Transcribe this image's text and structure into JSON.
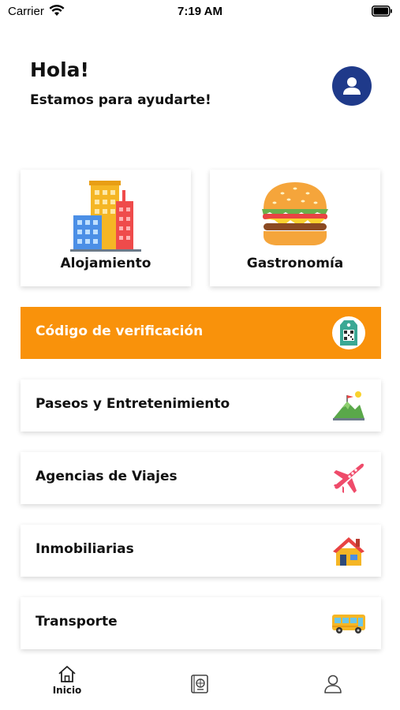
{
  "status_bar": {
    "carrier": "Carrier",
    "time": "7:19 AM"
  },
  "header": {
    "greeting": "Hola!",
    "subtitle": "Estamos para ayudarte!"
  },
  "categories": [
    {
      "label": "Alojamiento",
      "icon": "buildings-icon"
    },
    {
      "label": "Gastronomía",
      "icon": "burger-icon"
    }
  ],
  "menu": [
    {
      "label": "Código de verificación",
      "icon": "qr-tag-icon",
      "highlighted": true
    },
    {
      "label": "Paseos y Entretenimiento",
      "icon": "mountain-icon"
    },
    {
      "label": "Agencias de Viajes",
      "icon": "airplane-icon"
    },
    {
      "label": "Inmobiliarias",
      "icon": "house-icon"
    },
    {
      "label": "Transporte",
      "icon": "bus-icon"
    }
  ],
  "tab_bar": {
    "tabs": [
      {
        "label": "Inicio",
        "icon": "home-icon",
        "active": true
      },
      {
        "label": "",
        "icon": "passport-icon"
      },
      {
        "label": "",
        "icon": "user-icon"
      }
    ]
  },
  "colors": {
    "accent": "#f9920b",
    "avatar_bg": "#1f3a8a",
    "card_bg": "#ffffff"
  }
}
